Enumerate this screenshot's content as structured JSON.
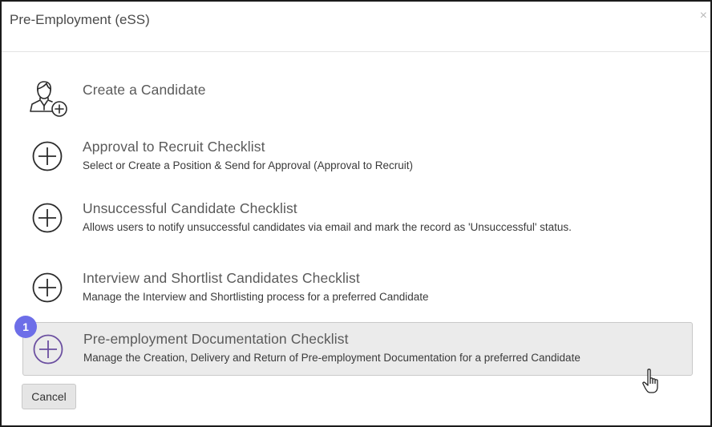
{
  "dialog": {
    "title": "Pre-Employment (eSS)",
    "close_glyph": "×"
  },
  "options": [
    {
      "icon": "user-add-icon",
      "title": "Create a Candidate",
      "description": ""
    },
    {
      "icon": "plus-circle-icon",
      "title": "Approval to Recruit Checklist",
      "description": "Select or Create a Position & Send for Approval (Approval to Recruit)"
    },
    {
      "icon": "plus-circle-icon",
      "title": "Unsuccessful Candidate Checklist",
      "description": "Allows users to notify unsuccessful candidates via email and mark the record as 'Unsuccessful' status."
    },
    {
      "icon": "plus-circle-icon",
      "title": "Interview and Shortlist Candidates Checklist",
      "description": "Manage the Interview and Shortlisting process for a preferred Candidate"
    },
    {
      "icon": "plus-circle-icon",
      "title": "Pre-employment Documentation Checklist",
      "description": "Manage the Creation, Delivery and Return of Pre-employment Documentation for a preferred Candidate",
      "highlighted": true
    }
  ],
  "step_badge": "1",
  "footer": {
    "cancel_label": "Cancel"
  },
  "colors": {
    "badge": "#6d6ee8",
    "highlight_icon": "#6b4fa0",
    "icon": "#2b2b2b",
    "highlight_bg": "#ebebeb"
  }
}
